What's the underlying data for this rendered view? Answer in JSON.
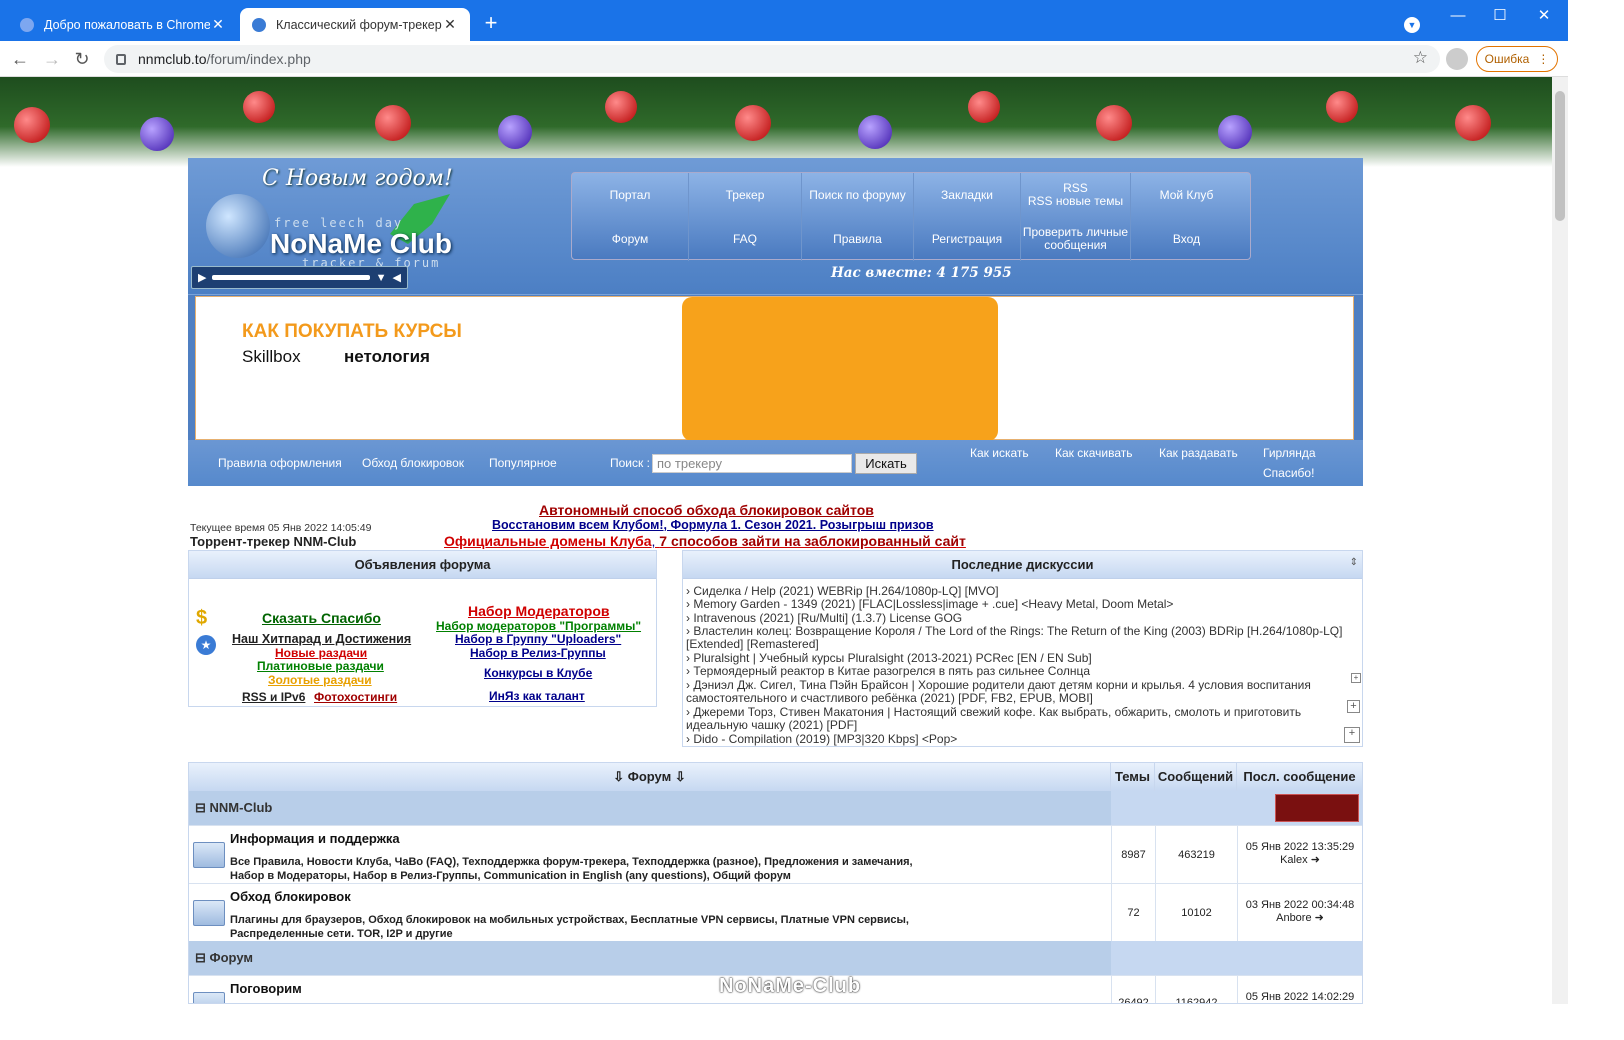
{
  "browser": {
    "tabs": [
      {
        "title": "Добро пожаловать в Chrome!"
      },
      {
        "title": "Классический форум-трекер :: N"
      }
    ],
    "url_host": "nnmclub.to",
    "url_path": "/forum/index.php",
    "error_label": "Ошибка"
  },
  "header": {
    "logo_greeting": "С Новым годом!",
    "logo_tagline": "free leech day",
    "logo_name": "NoNaMe Club",
    "logo_sub": "tracker & forum",
    "together": "Нас вместе: 4 175 955",
    "menu": [
      "Портал",
      "Трекер",
      "Поиск по форуму",
      "Закладки",
      "RSS\nRSS новые темы",
      "Мой Клуб",
      "Форум",
      "FAQ",
      "Правила",
      "Регистрация",
      "Проверить личные сообщения",
      "Вход"
    ]
  },
  "banner": {
    "title": "КАК ПОКУПАТЬ КУРСЫ",
    "brand1": "Skillbox",
    "brand2": "нетология"
  },
  "searchbar": {
    "links": [
      "Правила оформления",
      "Обход блокировок",
      "Популярное"
    ],
    "search_label": "Поиск :",
    "search_placeholder": "по трекеру",
    "search_button": "Искать",
    "right_links": [
      "Как искать",
      "Как скачивать",
      "Как раздавать",
      "Гирлянда",
      "Спасибо!"
    ]
  },
  "notices": {
    "line1": "Автономный способ обхода блокировок сайтов",
    "line2a": "Восстановим всем Клубом!",
    "line2b": "Формула 1. Сезон 2021. Розыгрыш призов",
    "line3a": "Официальные домены Клуба",
    "line3b": "7 способов зайти на заблокированный сайт",
    "time": "Текущее время 05 Янв 2022 14:05:49",
    "tracker": "Торрент-трекер NNM-Club"
  },
  "announcements": {
    "title": "Объявления форума",
    "thanks": "Сказать Спасибо",
    "hit": "Наш Хитпарад и Достижения",
    "new": "Новые раздачи",
    "platinum": "Платиновые раздачи",
    "gold": "Золотые раздачи",
    "rss": "RSS и IPv6",
    "photo": "Фотохостинги",
    "mods": "Набор Модераторов",
    "mods_prog": "Набор модераторов \"Программы\"",
    "uploaders": "Набор в Группу \"Uploaders\"",
    "release": "Набор в Релиз-Группы",
    "contests": "Конкурсы в Клубе",
    "lang": "ИнЯз как талант"
  },
  "discussions": {
    "title": "Последние дискуссии",
    "items": [
      "› Сиделка / Help (2021) WEBRip [H.264/1080p-LQ] [MVO]",
      "› Memory Garden - 1349 (2021) [FLAC|Lossless|image + .cue] <Heavy Metal, Doom Metal>",
      "› Intravenous (2021) [Ru/Multi] (1.3.7) License GOG",
      "› Властелин колец: Возвращение Короля / The Lord of the Rings: The Return of the King (2003) BDRip [H.264/1080p-LQ]",
      "  [Extended] [Remastered]",
      "› Pluralsight | Учебный курсы Pluralsight (2013-2021) PCRec [EN / EN Sub]",
      "› Термоядерный реактор в Китае разогрелся в пять раз сильнее Солнца",
      "› Дэниэл Дж. Сигел, Тина Пэйн Брайсон | Хорошие родители дают детям корни и крылья. 4 условия воспитания",
      "  самостоятельного и счастливого ребёнка (2021) [PDF, FB2, EPUB, MOBI]",
      "› Джереми Торз, Стивен Макатония | Настоящий свежий кофе. Как выбрать, обжарить, смолоть и приготовить",
      "  идеальную чашку (2021) [PDF]",
      "› Dido - Compilation (2019) [MP3|320 Kbps] <Pop>"
    ]
  },
  "forum": {
    "col_forum": "Форум",
    "col_topics": "Темы",
    "col_posts": "Сообщений",
    "col_last": "Посл. сообщение",
    "cat1": "NNM-Club",
    "cat2": "Форум",
    "rows": [
      {
        "title": "Информация и поддержка",
        "sub1": "Все Правила,  Новости Клуба,  ЧаВо (FAQ),  Техподдержка форум-трекера,  Техподдержка (разное),  Предложения и замечания,",
        "sub2": "Набор в Модераторы,  Набор в Релиз-Группы,  Communication in English (any questions),  Общий форум",
        "topics": "8987",
        "posts": "463219",
        "last_date": "05 Янв 2022 13:35:29",
        "last_user": "Kalex"
      },
      {
        "title": "Обход блокировок",
        "sub1": "Плагины для браузеров,  Обход блокировок на мобильных устройствах,  Бесплатные VPN сервисы,  Платные VPN сервисы,",
        "sub2": "Распределенные сети. TOR, I2P и другие",
        "topics": "72",
        "posts": "10102",
        "last_date": "03 Янв 2022 00:34:48",
        "last_user": "Anbore"
      },
      {
        "title": "Поговорим",
        "topics": "26492",
        "posts": "1162942",
        "last_date": "05 Янв 2022 14:02:29"
      }
    ],
    "watermark": "NoNaMe-Club"
  }
}
